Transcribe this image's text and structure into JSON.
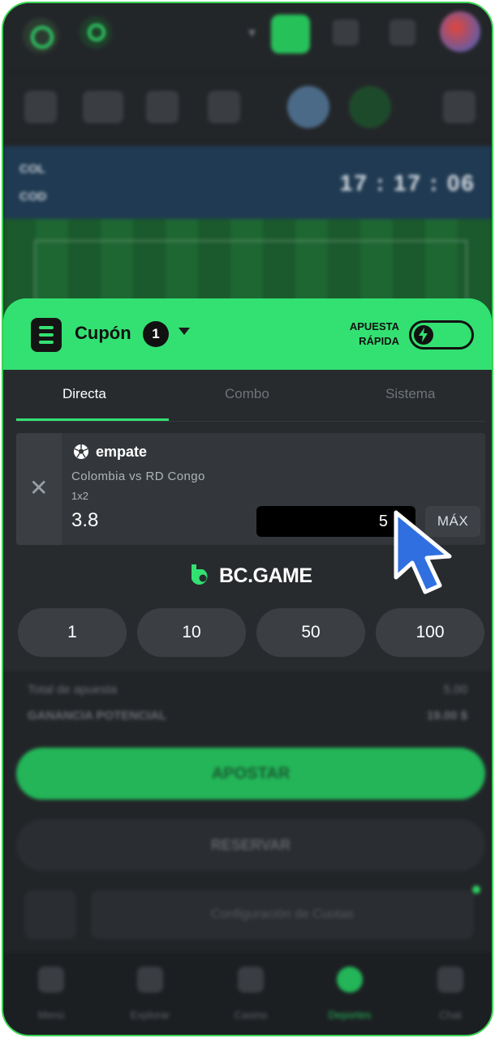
{
  "coupon": {
    "title": "Cupón",
    "count": "1",
    "quick_bet_line1": "APUESTA",
    "quick_bet_line2": "RÁPIDA"
  },
  "tabs": [
    {
      "label": "Directa",
      "active": true
    },
    {
      "label": "Combo",
      "active": false
    },
    {
      "label": "Sistema",
      "active": false
    }
  ],
  "bet": {
    "selection": "empate",
    "match": "Colombia vs RD Congo",
    "market": "1x2",
    "odds": "3.8",
    "stake": "5",
    "max_label": "MÁX"
  },
  "brand": {
    "name": "BC.GAME"
  },
  "quick_stakes": [
    "1",
    "10",
    "50",
    "100"
  ],
  "background_match": {
    "team1": "COL",
    "team2": "COD",
    "clock": "17 : 17 : 06"
  },
  "summary": {
    "total_label": "Total de apuesta",
    "total_value": "5.00",
    "potential_label": "GANANCIA POTENCIAL",
    "potential_value": "19.00 $"
  },
  "actions": {
    "bet_label": "APOSTAR",
    "reserve_label": "RESERVAR",
    "config_label": "Configuración de Cuotas"
  },
  "bottom_nav": [
    {
      "label": "Menú"
    },
    {
      "label": "Explorar"
    },
    {
      "label": "Casino"
    },
    {
      "label": "Deportes"
    },
    {
      "label": "Chat"
    }
  ],
  "colors": {
    "accent": "#33e172",
    "background": "#282b2e",
    "cursor": "#2f6fe0"
  }
}
